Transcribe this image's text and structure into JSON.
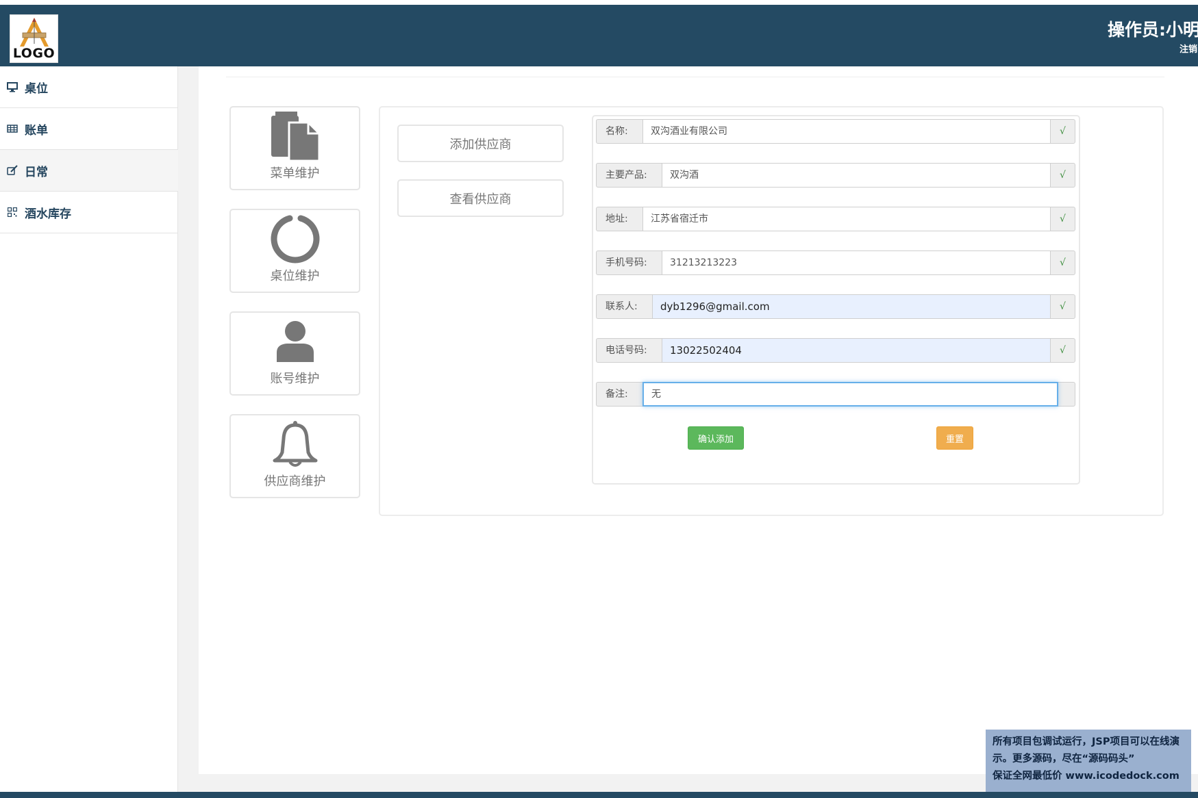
{
  "header": {
    "logo_text": "LOGO",
    "operator": "操作员:小明",
    "logout": "注销"
  },
  "sidebar": {
    "items": [
      {
        "label": "桌位",
        "icon": "monitor-icon"
      },
      {
        "label": "账单",
        "icon": "table-icon"
      },
      {
        "label": "日常",
        "icon": "edit-icon",
        "active": true
      },
      {
        "label": "酒水库存",
        "icon": "qrcode-icon"
      }
    ]
  },
  "tiles": [
    {
      "label": "菜单维护",
      "icon": "copy-icon"
    },
    {
      "label": "桌位维护",
      "icon": "circle-icon"
    },
    {
      "label": "账号维护",
      "icon": "user-icon"
    },
    {
      "label": "供应商维护",
      "icon": "bell-icon"
    }
  ],
  "supplier_buttons": {
    "add": "添加供应商",
    "view": "查看供应商"
  },
  "form": {
    "fields": [
      {
        "label": "名称:",
        "value": "双沟酒业有限公司",
        "check": "√"
      },
      {
        "label": "主要产品:",
        "value": "双沟酒",
        "check": "√"
      },
      {
        "label": "地址:",
        "value": "江苏省宿迁市",
        "check": "√"
      },
      {
        "label": "手机号码:",
        "value": "31213213223",
        "check": "√"
      },
      {
        "label": "联系人:",
        "value": "dyb1296@gmail.com",
        "check": "√"
      },
      {
        "label": "电话号码:",
        "value": "13022502404",
        "check": "√"
      },
      {
        "label": "备注:",
        "value": "无",
        "check": ""
      }
    ],
    "confirm_label": "确认添加",
    "reset_label": "重置"
  },
  "watermark": {
    "line1": "所有项目包调试运行，JSP项目可以在线演",
    "line2": "示。更多源码，尽在“源码码头”",
    "line3": "保证全网最低价 www.icodedock.com"
  },
  "colors": {
    "header": "#244a63",
    "success": "#5cb85c",
    "warning": "#f0ad4e",
    "autofill": "#e8f0fe",
    "focus": "#66afe9"
  }
}
